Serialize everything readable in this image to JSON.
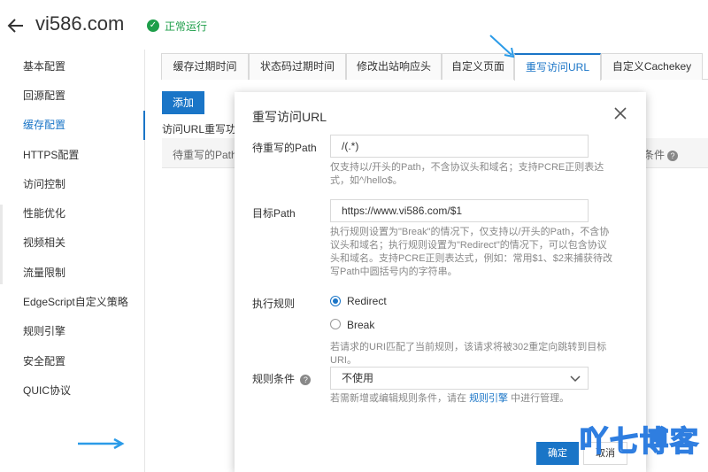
{
  "header": {
    "back_icon": "arrow-left-icon",
    "title": "vi586.com",
    "status_icon": "check-circle-icon",
    "status_text": "正常运行"
  },
  "sidebar": {
    "items": [
      {
        "label": "基本配置"
      },
      {
        "label": "回源配置"
      },
      {
        "label": "缓存配置",
        "active": true
      },
      {
        "label": "HTTPS配置"
      },
      {
        "label": "访问控制"
      },
      {
        "label": "性能优化"
      },
      {
        "label": "视频相关"
      },
      {
        "label": "流量限制"
      },
      {
        "label": "EdgeScript自定义策略"
      },
      {
        "label": "规则引擎"
      },
      {
        "label": "安全配置"
      },
      {
        "label": "QUIC协议"
      }
    ]
  },
  "tabs": [
    {
      "label": "缓存过期时间"
    },
    {
      "label": "状态码过期时间"
    },
    {
      "label": "修改出站响应头"
    },
    {
      "label": "自定义页面"
    },
    {
      "label": "重写访问URL",
      "active": true
    },
    {
      "label": "自定义Cachekey"
    }
  ],
  "main": {
    "add_button": "添加",
    "section_label": "访问URL重写功能",
    "table_headers": [
      "待重写的Path",
      "条件"
    ]
  },
  "modal": {
    "title": "重写访问URL",
    "close_icon": "close-icon",
    "path_label": "待重写的Path",
    "path_value": "/(.*)",
    "path_help": "仅支持以/开头的Path，不含协议头和域名；支持PCRE正则表达式，如^/hello$。",
    "target_label": "目标Path",
    "target_value": "https://www.vi586.com/$1",
    "target_help": "执行规则设置为\"Break\"的情况下，仅支持以/开头的Path，不含协议头和域名；执行规则设置为\"Redirect\"的情况下，可以包含协议头和域名。支持PCRE正则表达式，例如：常用$1、$2来捕获待改写Path中圆括号内的字符串。",
    "rule_label": "执行规则",
    "options": [
      {
        "label": "Redirect",
        "checked": true
      },
      {
        "label": "Break",
        "checked": false
      }
    ],
    "rule_help": "若请求的URI匹配了当前规则，该请求将被302重定向跳转到目标URI。",
    "condition_label": "规则条件",
    "condition_value": "不使用",
    "condition_help_prefix": "若需新增或编辑规则条件，请在",
    "condition_help_link": "规则引擎",
    "condition_help_suffix": "中进行管理。",
    "ok_button": "确定",
    "cancel_button": "取消"
  },
  "watermark": "吖七博客",
  "colors": {
    "accent": "#1a75c7",
    "status_green": "#1e9e4a",
    "annotation_arrow": "#2b9be8"
  }
}
